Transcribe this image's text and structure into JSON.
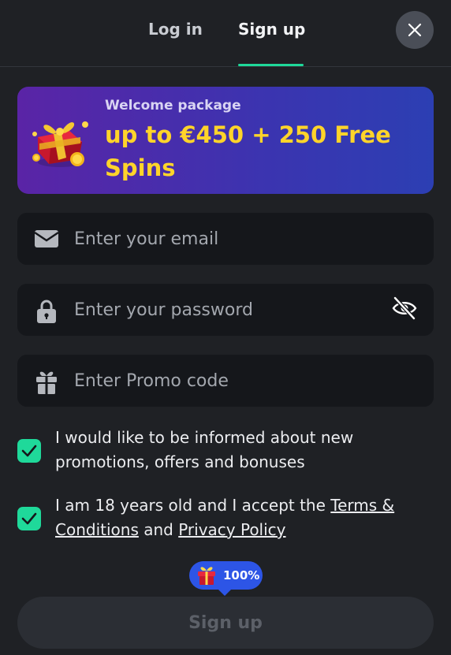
{
  "tabs": {
    "login_label": "Log in",
    "signup_label": "Sign up",
    "active": "signup"
  },
  "close_icon": "close-icon",
  "banner": {
    "subtitle": "Welcome package",
    "title": "up to €450 + 250 Free Spins",
    "icon": "gift-box-icon"
  },
  "form": {
    "email": {
      "placeholder": "Enter your email",
      "value": "",
      "icon": "envelope-icon"
    },
    "password": {
      "placeholder": "Enter your password",
      "value": "",
      "icon": "lock-icon",
      "toggle_icon": "eye-hidden-icon"
    },
    "promo": {
      "placeholder": "Enter Promo code",
      "value": "",
      "icon": "gift-icon"
    }
  },
  "consents": {
    "marketing": {
      "checked": true,
      "text": "I would like to be informed about new promotions, offers and bonuses"
    },
    "terms": {
      "checked": true,
      "prefix": "I am 18 years old and I accept the ",
      "terms_link": "Terms & Conditions",
      "joiner": " and ",
      "privacy_link": "Privacy Policy"
    }
  },
  "badge": {
    "text": "100%",
    "icon": "gift-icon"
  },
  "submit": {
    "label": "Sign up"
  },
  "colors": {
    "background": "#1f2125",
    "accent": "#1fd99a",
    "banner_gold": "#ffd42a",
    "badge_blue": "#2d55e6",
    "field_bg": "#15171b"
  }
}
